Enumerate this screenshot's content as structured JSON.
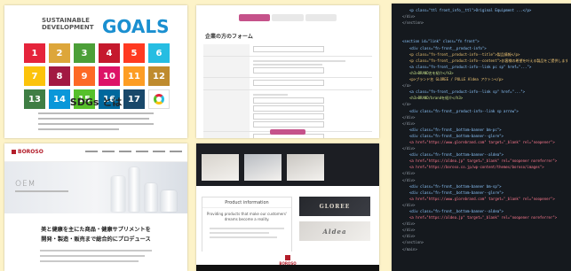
{
  "sdgs": {
    "logo_small": "SUSTAINABLE DEVELOPMENT",
    "logo_big": "GOALS",
    "title": "SDGs とは",
    "tiles": [
      {
        "n": "1",
        "color": "#e5243b"
      },
      {
        "n": "2",
        "color": "#dda63a"
      },
      {
        "n": "3",
        "color": "#4c9f38"
      },
      {
        "n": "4",
        "color": "#c5192d"
      },
      {
        "n": "5",
        "color": "#ff3a21"
      },
      {
        "n": "6",
        "color": "#26bde2"
      },
      {
        "n": "7",
        "color": "#fcc30b"
      },
      {
        "n": "8",
        "color": "#a21942"
      },
      {
        "n": "9",
        "color": "#fd6925"
      },
      {
        "n": "10",
        "color": "#dd1367"
      },
      {
        "n": "11",
        "color": "#fd9d24"
      },
      {
        "n": "12",
        "color": "#bf8b2e"
      },
      {
        "n": "13",
        "color": "#3f7e44"
      },
      {
        "n": "14",
        "color": "#0a97d9"
      },
      {
        "n": "15",
        "color": "#56c02b"
      },
      {
        "n": "16",
        "color": "#00689d"
      },
      {
        "n": "17",
        "color": "#19486a"
      },
      {
        "n": "",
        "color": "#ffffff"
      }
    ]
  },
  "form": {
    "title": "企業の方のフォーム",
    "header_colors": [
      "#c5528a",
      "#e8e8e8",
      "#e8e8e8"
    ],
    "submit_color": "#c5528a"
  },
  "corp": {
    "logo": "BOROSO",
    "hero_text": "OEM",
    "headline_line1": "美と健康を主にた商品・健康サプリメントを",
    "headline_line2": "開発・製造・販売まで総合的にプロデュース"
  },
  "product": {
    "card_title": "Product information",
    "card_body": "Providing products that make our customers' dreams become a reality.",
    "brand_1": "GLOREE",
    "brand_2": "Aldea",
    "footer_logo": "BOROSO",
    "image_colors": [
      "#d7d3cc",
      "#b8bcc2",
      "#c9c6c1"
    ]
  },
  "code": {
    "lines": [
      {
        "text": "<p class=\"ttl front_info__ttl\">Original Equipment ...</p>",
        "color": "#8ec8ff"
      },
      {
        "text": "</div>",
        "color": "#9aa3ad"
      },
      {
        "text": "</section>",
        "color": "#9aa3ad"
      },
      {
        "text": "",
        "color": "#9aa3ad"
      },
      {
        "text": "",
        "color": "#9aa3ad"
      },
      {
        "text": "<section id=\"link\" class=\"fn front\">",
        "color": "#8ec8ff"
      },
      {
        "text": "<div class=\"fn-front__product-info\">",
        "color": "#8ec8ff"
      },
      {
        "text": "<p class=\"fn-front__product-info--title\">製品情報</p>",
        "color": "#f0c674"
      },
      {
        "text": "<p class=\"fn-front__product-info--content\">お客様の希望を叶える製品をご提供します</p>",
        "color": "#f0c674"
      },
      {
        "text": "<a class=\"fn-front__product-info--link pc sp\" href=\"...\">",
        "color": "#8ec8ff"
      },
      {
        "text": "<h3>BRAND名を紹介</h3>",
        "color": "#c7e08a"
      },
      {
        "text": "<p>ブランド名 GLOREE / POLLE Aldea アクトン</p>",
        "color": "#f0c674"
      },
      {
        "text": "</a>",
        "color": "#9aa3ad"
      },
      {
        "text": "<a class=\"fn-front__product-info--link sp\" href=\"...\">",
        "color": "#8ec8ff"
      },
      {
        "text": "<h3>BRAND/brandを紹介</h3>",
        "color": "#c7e08a"
      },
      {
        "text": "</a>",
        "color": "#9aa3ad"
      },
      {
        "text": "<div class=\"fn-front__product-info--link sp arrow\">",
        "color": "#8ec8ff"
      },
      {
        "text": "</div>",
        "color": "#9aa3ad"
      },
      {
        "text": "</div>",
        "color": "#9aa3ad"
      },
      {
        "text": "<div class=\"fn-front__bottom-banner bm-pc\">",
        "color": "#8ec8ff"
      },
      {
        "text": "<div class=\"fn-front__bottom-banner--glore\">",
        "color": "#8ec8ff"
      },
      {
        "text": "<a href=\"https://www.glorebrand.com\" target=\"_blank\" rel=\"noopener\">",
        "color": "#ff7a90"
      },
      {
        "text": "</div>",
        "color": "#9aa3ad"
      },
      {
        "text": "<div class=\"fn-front__bottom-banner--aldea\">",
        "color": "#8ec8ff"
      },
      {
        "text": "<a href=\"https://aldea.jp\" target=\"_blank\" rel=\"noopener noreferrer\">",
        "color": "#ff7a90"
      },
      {
        "text": "<a href=\"https://boroso.co.jp/wp-content/themes/boroso/images\">",
        "color": "#ff7a90"
      },
      {
        "text": "</div>",
        "color": "#9aa3ad"
      },
      {
        "text": "</div>",
        "color": "#9aa3ad"
      },
      {
        "text": "<div class=\"fn-front__bottom-banner bm-sp\">",
        "color": "#8ec8ff"
      },
      {
        "text": "<div class=\"fn-front__bottom-banner--glore\">",
        "color": "#8ec8ff"
      },
      {
        "text": "<a href=\"https://www.glorebrand.com\" target=\"_blank\" rel=\"noopener\">",
        "color": "#ff7a90"
      },
      {
        "text": "</div>",
        "color": "#9aa3ad"
      },
      {
        "text": "<div class=\"fn-front__bottom-banner--aldea\">",
        "color": "#8ec8ff"
      },
      {
        "text": "<a href=\"https://aldea.jp\" target=\"_blank\" rel=\"noopener noreferrer\">",
        "color": "#ff7a90"
      },
      {
        "text": "</div>",
        "color": "#9aa3ad"
      },
      {
        "text": "</div>",
        "color": "#9aa3ad"
      },
      {
        "text": "</div>",
        "color": "#9aa3ad"
      },
      {
        "text": "</section>",
        "color": "#9aa3ad"
      },
      {
        "text": "</main>",
        "color": "#9aa3ad"
      }
    ]
  }
}
